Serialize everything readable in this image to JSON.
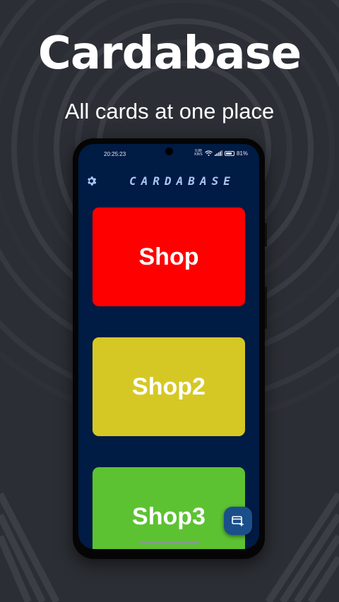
{
  "hero": {
    "title": "Cardabase",
    "subtitle": "All cards at one place"
  },
  "status_bar": {
    "time": "20:25:23",
    "net_speed_value": "0.88",
    "net_speed_unit": "KB/S",
    "battery_level": "81%",
    "battery_fraction": 0.81
  },
  "app_bar": {
    "title": "CARDABASE",
    "settings_icon": "gear-icon"
  },
  "cards": [
    {
      "name": "Shop",
      "color": "#ff0000"
    },
    {
      "name": "Shop2",
      "color": "#d6c824"
    },
    {
      "name": "Shop3",
      "color": "#5cc232"
    }
  ],
  "fab": {
    "icon": "add-card-icon"
  },
  "colors": {
    "background": "#2b2e34",
    "screen": "#001b44",
    "accent_title": "#a9c7f5",
    "fab": "#1a4f8b"
  }
}
